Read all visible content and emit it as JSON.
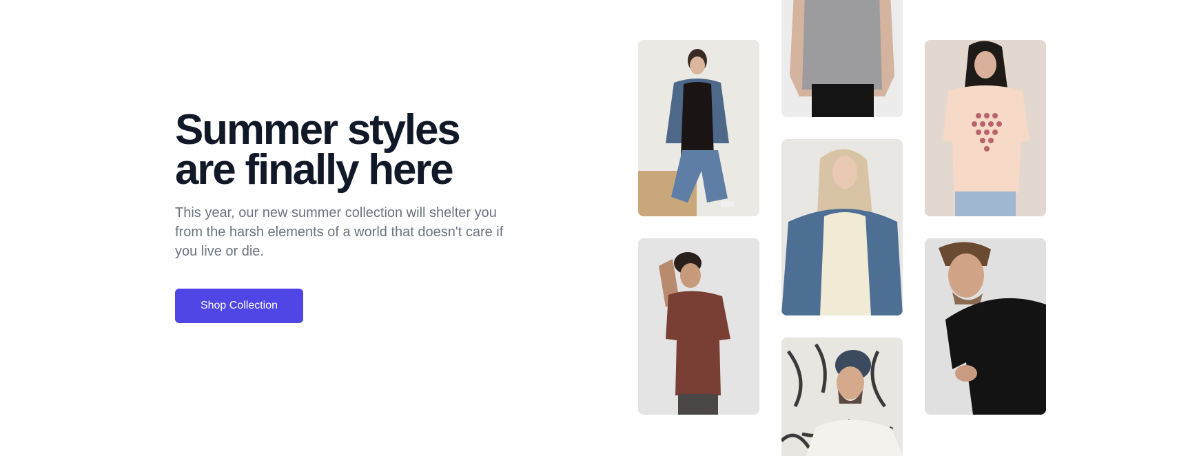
{
  "hero": {
    "headline_line1": "Summer styles",
    "headline_line2": "are finally here",
    "subtext": "This year, our new summer collection will shelter you from the harsh elements of a world that doesn't care if you live or die.",
    "cta_label": "Shop Collection"
  },
  "colors": {
    "accent": "#4f46e5",
    "heading": "#111827",
    "body_text": "#6b7280"
  },
  "gallery": {
    "images": [
      {
        "name": "woman-denim-jacket-black-tee-photo"
      },
      {
        "name": "man-brown-tee-hand-in-hair-photo"
      },
      {
        "name": "gray-tee-torso-photo"
      },
      {
        "name": "blonde-woman-denim-jacket-cream-tee-photo"
      },
      {
        "name": "bearded-man-beanie-glasses-photo"
      },
      {
        "name": "woman-peach-graphic-tee-photo"
      },
      {
        "name": "man-black-tee-looking-down-photo"
      }
    ]
  }
}
